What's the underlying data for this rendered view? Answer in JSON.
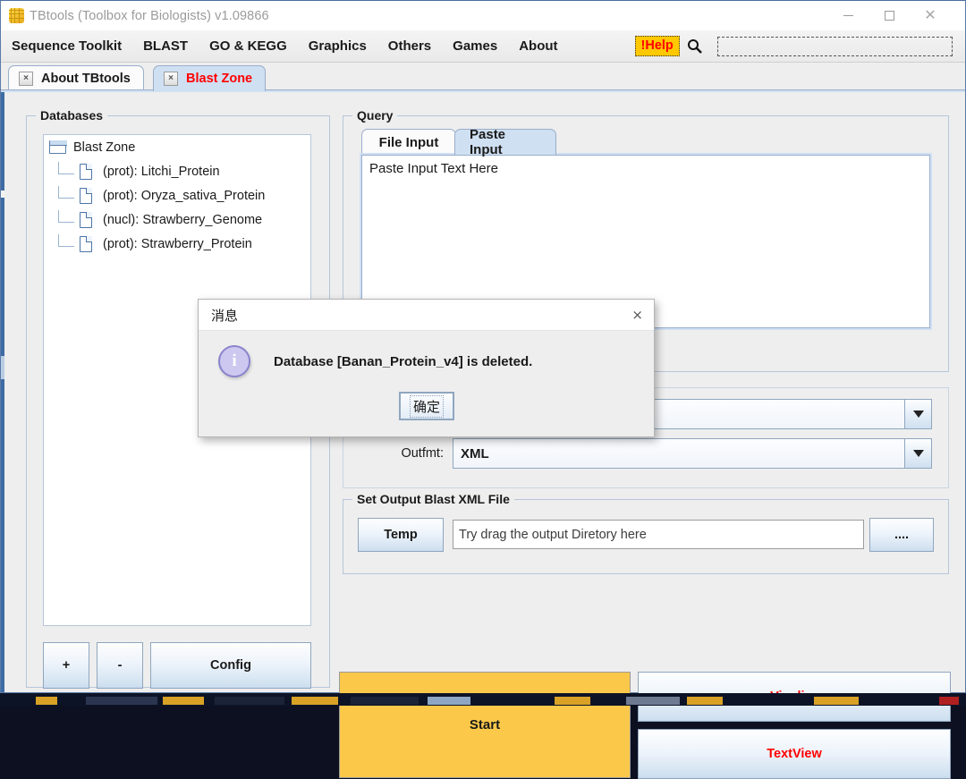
{
  "window": {
    "title": "TBtools (Toolbox for Biologists) v1.09866",
    "app_icon": "tbtools-grid-icon",
    "controls": {
      "minimize": "minimize-icon",
      "maximize": "maximize-icon",
      "close": "close-icon"
    }
  },
  "menubar": {
    "items": [
      {
        "label": "Sequence Toolkit"
      },
      {
        "label": "BLAST"
      },
      {
        "label": "GO & KEGG"
      },
      {
        "label": "Graphics"
      },
      {
        "label": "Others"
      },
      {
        "label": "Games"
      },
      {
        "label": "About"
      }
    ],
    "help_label": "!Help",
    "help_bg": "#ffc800",
    "help_fg": "#ff0000",
    "search_icon": "search-icon",
    "search_value": ""
  },
  "tabs": [
    {
      "label": "About TBtools",
      "close": "×",
      "active": false,
      "color": "#1a1a1a"
    },
    {
      "label": "Blast Zone",
      "close": "×",
      "active": true,
      "color": "#ff0000"
    }
  ],
  "databases": {
    "group_label": "Databases",
    "tree": {
      "root": "Blast Zone",
      "children": [
        "(prot): Litchi_Protein",
        "(prot): Oryza_sativa_Protein",
        "(nucl): Strawberry_Genome",
        "(prot): Strawberry_Protein"
      ]
    },
    "buttons": {
      "add": "+",
      "remove": "-",
      "config": "Config"
    }
  },
  "query": {
    "group_label": "Query",
    "tabs": [
      {
        "label": "File Input",
        "active": false
      },
      {
        "label": "Paste Input",
        "active": true
      }
    ],
    "paste_text": "Paste Input Text Here"
  },
  "params": {
    "program_label": "",
    "program_value": "",
    "outfmt_label": "Outfmt:",
    "outfmt_value": "XML"
  },
  "output": {
    "group_label": "Set Output Blast XML File",
    "temp_label": "Temp",
    "path_placeholder": "Try drag the output Diretory here",
    "path_value": "",
    "browse_label": "...."
  },
  "actions": {
    "start_label": "Start",
    "start_bg": "#fbc84a",
    "visulize_label": "Visulize",
    "textview_label": "TextView",
    "action_fg": "#ff0000"
  },
  "dialog": {
    "title": "消息",
    "close": "×",
    "icon": "info-icon",
    "message": "Database [Banan_Protein_v4] is deleted.",
    "ok_label": "确定"
  }
}
